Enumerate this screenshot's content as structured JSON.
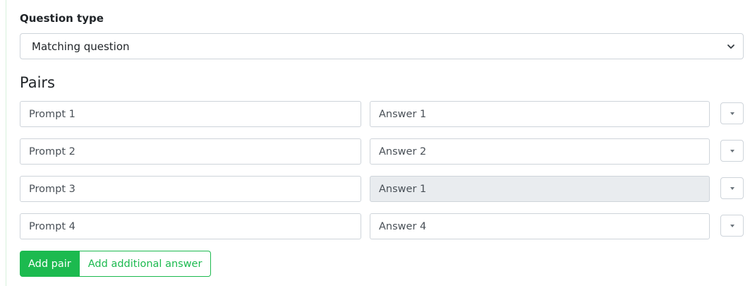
{
  "question_type": {
    "label": "Question type",
    "selected": "Matching question"
  },
  "pairs_section": {
    "title": "Pairs",
    "rows": [
      {
        "prompt": "Prompt 1",
        "answer": "Answer 1",
        "answer_disabled": false
      },
      {
        "prompt": "Prompt 2",
        "answer": "Answer 2",
        "answer_disabled": false
      },
      {
        "prompt": "Prompt 3",
        "answer": "Answer 1",
        "answer_disabled": true
      },
      {
        "prompt": "Prompt 4",
        "answer": "Answer 4",
        "answer_disabled": false
      }
    ]
  },
  "actions": {
    "add_pair": "Add pair",
    "add_additional_answer": "Add additional answer"
  },
  "colors": {
    "accent": "#1cba4f",
    "disabled_bg": "#e9ecef",
    "border": "#ced4da"
  },
  "icons": {
    "select": "chevron-down-icon",
    "row_dropdown": "caret-down-icon"
  }
}
